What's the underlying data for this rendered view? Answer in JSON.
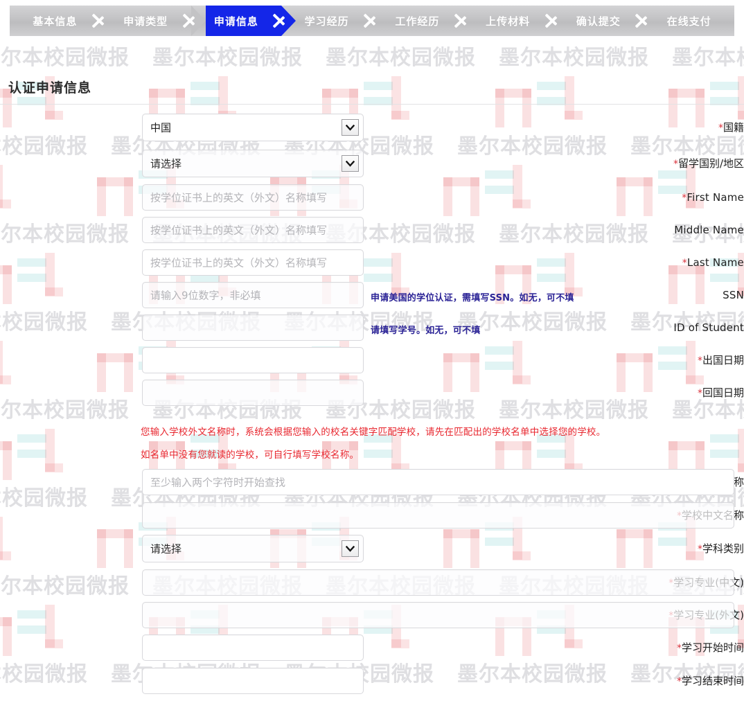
{
  "steps": [
    {
      "label": "基本信息",
      "active": false
    },
    {
      "label": "申请类型",
      "active": false
    },
    {
      "label": "申请信息",
      "active": true
    },
    {
      "label": "学习经历",
      "active": false
    },
    {
      "label": "工作经历",
      "active": false
    },
    {
      "label": "上传材料",
      "active": false
    },
    {
      "label": "确认提交",
      "active": false
    },
    {
      "label": "在线支付",
      "active": false
    }
  ],
  "section": {
    "title": "认证申请信息"
  },
  "fields": {
    "nationality": {
      "label": "国籍",
      "required": true,
      "value": "中国",
      "type": "select"
    },
    "study_country": {
      "label": "留学国别/地区",
      "required": true,
      "value": "请选择",
      "type": "select"
    },
    "first_name": {
      "label": "First Name",
      "required": true,
      "placeholder": "按学位证书上的英文（外文）名称填写",
      "type": "text"
    },
    "middle_name": {
      "label": "Middle Name",
      "required": false,
      "placeholder": "按学位证书上的英文（外文）名称填写",
      "type": "text"
    },
    "last_name": {
      "label": "Last Name",
      "required": true,
      "placeholder": "按学位证书上的英文（外文）名称填写",
      "type": "text"
    },
    "ssn": {
      "label": "SSN",
      "required": false,
      "placeholder": "请输入9位数字，非必填",
      "type": "text",
      "hint": "申请美国的学位认证，需填写SSN。如无，可不填"
    },
    "id_of_student": {
      "label": "ID of Student",
      "required": false,
      "placeholder": "",
      "type": "text",
      "hint": "请填写学号。如无，可不填"
    },
    "depart_date": {
      "label": "出国日期",
      "required": true,
      "placeholder": "",
      "type": "text"
    },
    "return_date": {
      "label": "回国日期",
      "required": true,
      "placeholder": "",
      "type": "text"
    },
    "school_foreign": {
      "label": "学校外文名称",
      "required": true,
      "placeholder": "至少输入两个字符时开始查找",
      "type": "text"
    },
    "school_chinese": {
      "label": "学校中文名称",
      "required": true,
      "placeholder": "",
      "type": "text"
    },
    "subject_category": {
      "label": "学科类别",
      "required": true,
      "value": "请选择",
      "type": "select"
    },
    "major_cn": {
      "label": "学习专业(中文)",
      "required": true,
      "placeholder": "",
      "type": "text"
    },
    "major_foreign": {
      "label": "学习专业(外文)",
      "required": true,
      "placeholder": "",
      "type": "text"
    },
    "study_start": {
      "label": "学习开始时间",
      "required": true,
      "placeholder": "",
      "type": "text"
    },
    "study_end": {
      "label": "学习结束时间",
      "required": true,
      "placeholder": "",
      "type": "text"
    }
  },
  "warnings": [
    "您输入学校外文名称时，系统会根据您输入的校名关键字匹配学校，请先在匹配出的学校名单中选择您的学校。",
    "如名单中没有您就读的学校，可自行填写学校名称。"
  ],
  "watermark": {
    "text": "墨尔本校园微报",
    "logo": "mel-logo"
  },
  "colors": {
    "active_step": "#1426e8",
    "required_star": "#d9323c",
    "warning_text": "#e8272f",
    "hint_text": "#2b2396"
  },
  "icons": {
    "chevron_right": "chevron-right-icon",
    "chevron_down": "chevron-down-icon"
  }
}
